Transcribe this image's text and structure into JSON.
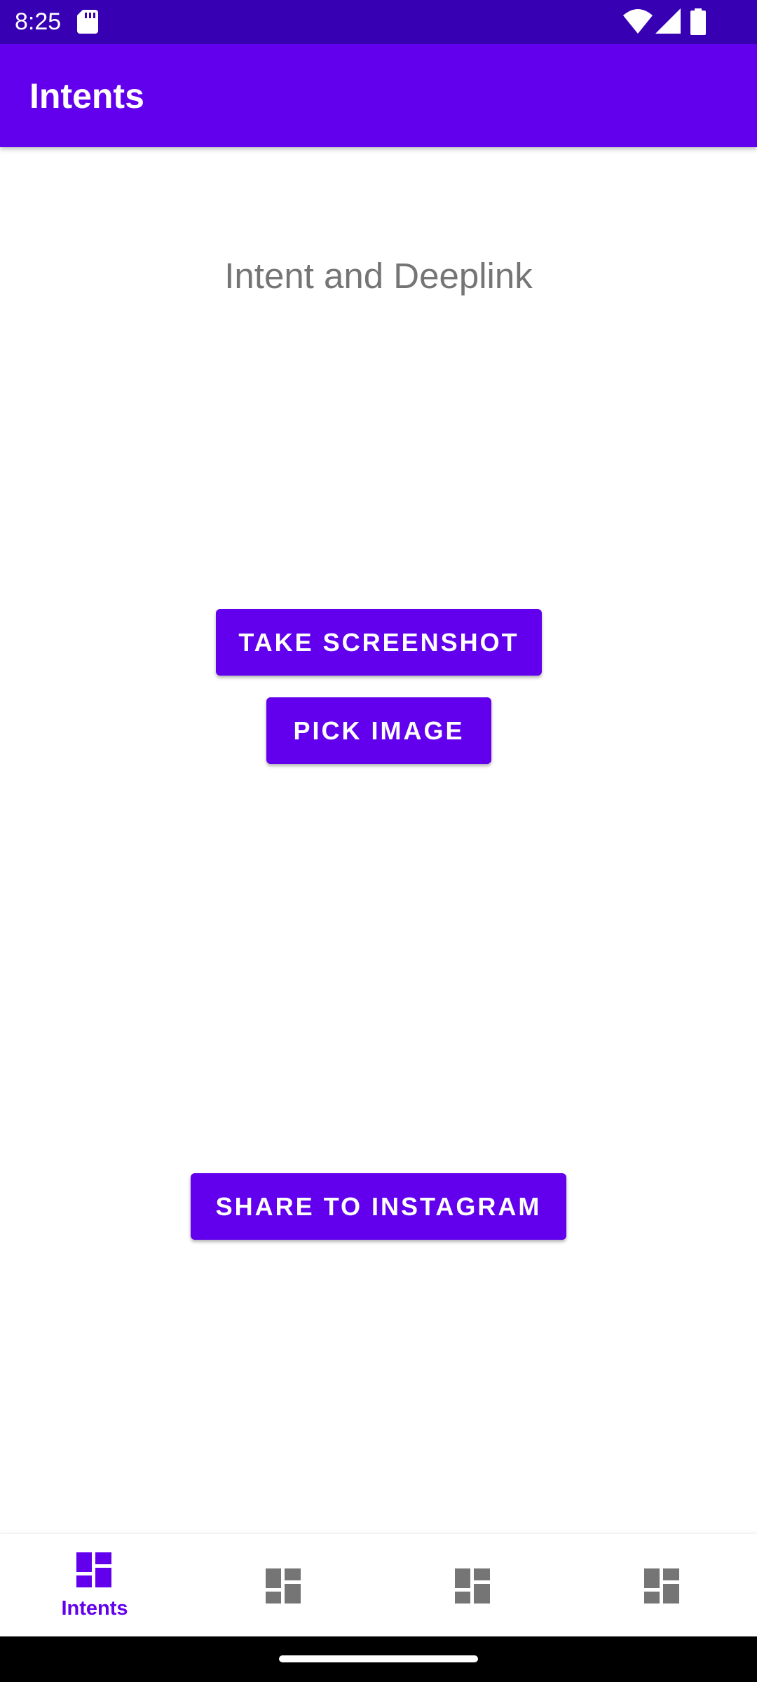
{
  "status_bar": {
    "time": "8:25",
    "icons": [
      "sd-card-icon",
      "wifi-icon",
      "signal-icon",
      "battery-icon"
    ]
  },
  "app_bar": {
    "title": "Intents"
  },
  "main": {
    "heading": "Intent and Deeplink",
    "buttons": {
      "take_screenshot": "TAKE SCREENSHOT",
      "pick_image": "PICK IMAGE",
      "share_to_instagram": "SHARE TO INSTAGRAM"
    }
  },
  "bottom_nav": {
    "items": [
      {
        "label": "Intents",
        "icon": "dashboard-icon",
        "active": true
      },
      {
        "label": "",
        "icon": "dashboard-icon",
        "active": false
      },
      {
        "label": "",
        "icon": "dashboard-icon",
        "active": false
      },
      {
        "label": "",
        "icon": "dashboard-icon",
        "active": false
      }
    ]
  },
  "colors": {
    "primary": "#6200EE",
    "primary_dark": "#3700B3",
    "inactive_icon": "#757575",
    "heading_text": "#757575"
  }
}
